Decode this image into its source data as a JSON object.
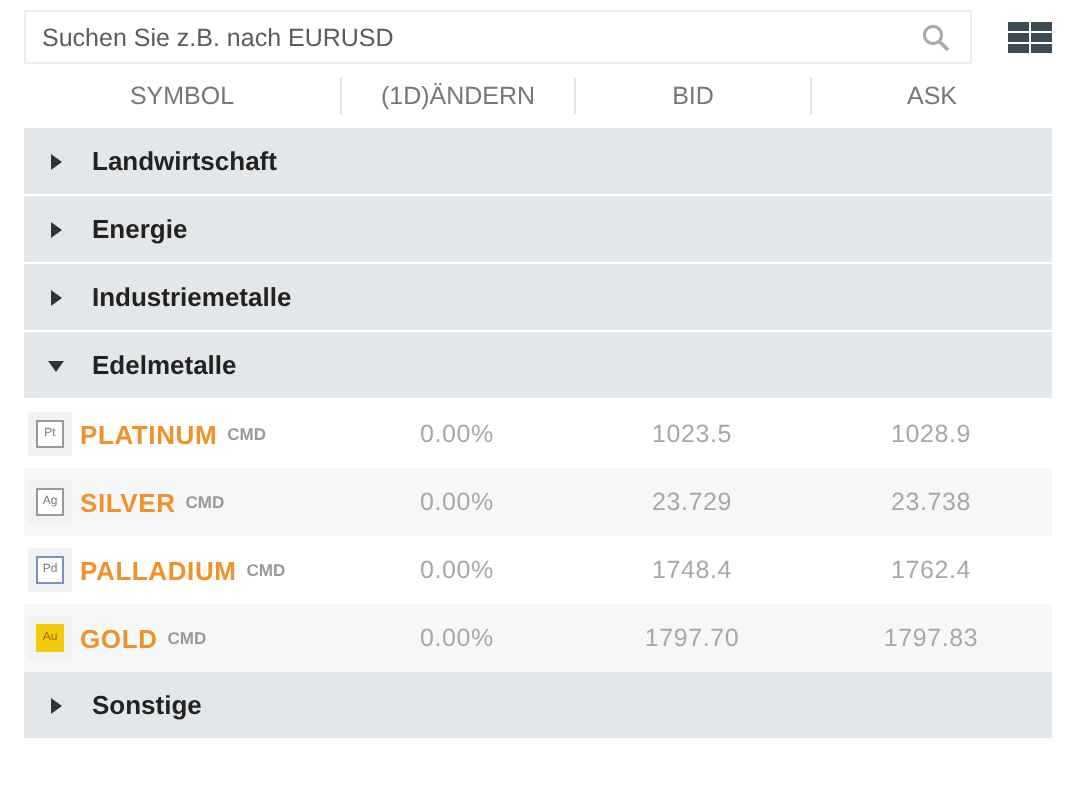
{
  "search": {
    "placeholder": "Suchen Sie z.B. nach EURUSD"
  },
  "columns": [
    "SYMBOL",
    "(1D)ÄNDERN",
    "BID",
    "ASK"
  ],
  "groups": [
    {
      "name": "Landwirtschaft",
      "expanded": false
    },
    {
      "name": "Energie",
      "expanded": false
    },
    {
      "name": "Industriemetalle",
      "expanded": false
    },
    {
      "name": "Edelmetalle",
      "expanded": true,
      "rows": [
        {
          "badge": "Pt",
          "color": "#9a9a9a",
          "symbol": "PLATINUM",
          "type": "CMD",
          "change": "0.00%",
          "bid": "1023.5",
          "ask": "1028.9"
        },
        {
          "badge": "Ag",
          "color": "#9a9a9a",
          "symbol": "SILVER",
          "type": "CMD",
          "change": "0.00%",
          "bid": "23.729",
          "ask": "23.738"
        },
        {
          "badge": "Pd",
          "color": "#7d8fc4",
          "symbol": "PALLADIUM",
          "type": "CMD",
          "change": "0.00%",
          "bid": "1748.4",
          "ask": "1762.4"
        },
        {
          "badge": "Au",
          "color": "#f2cc0c",
          "symbol": "GOLD",
          "type": "CMD",
          "change": "0.00%",
          "bid": "1797.70",
          "ask": "1797.83"
        }
      ]
    },
    {
      "name": "Sonstige",
      "expanded": false
    }
  ]
}
